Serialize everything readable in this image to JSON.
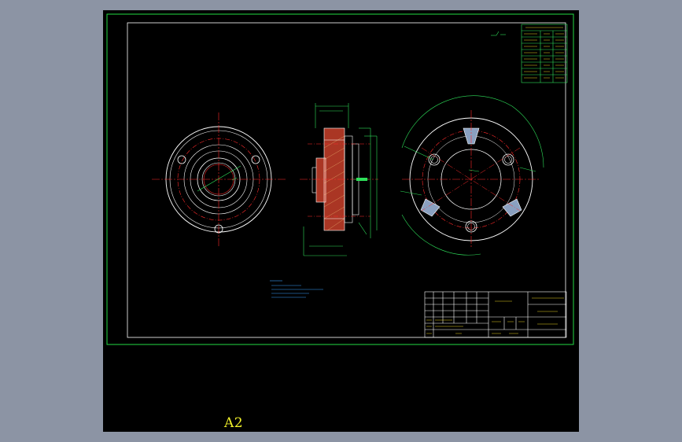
{
  "sheet": {
    "size_label": "A2"
  },
  "colors": {
    "background": "#000000",
    "frame": "#22dd44",
    "outline": "#ffffff",
    "center": "#ff2a2a",
    "dimension": "#2ee05a",
    "note": "#3aa0ff",
    "title_text": "#e8d020",
    "desktop": "#8c94a4"
  },
  "icons": [
    "drawing-canvas"
  ]
}
